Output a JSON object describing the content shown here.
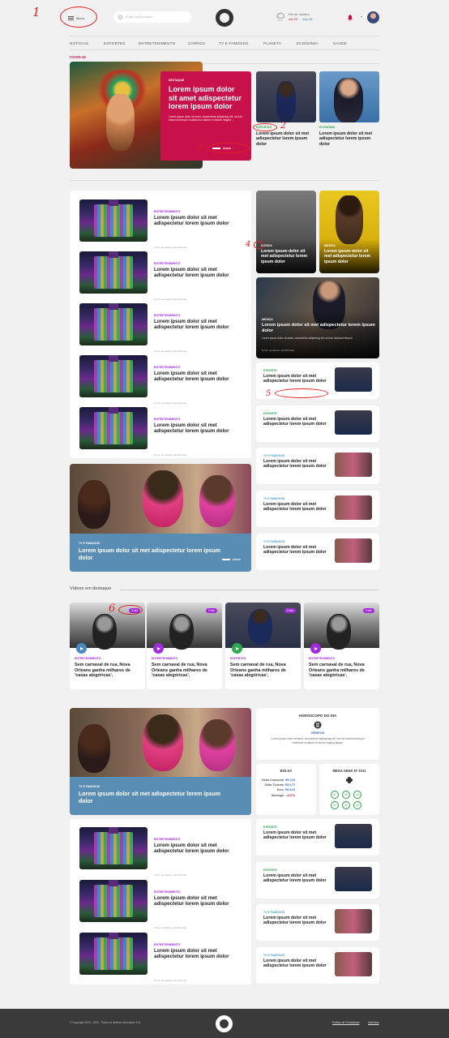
{
  "header": {
    "menu_label": "Menu",
    "search_placeholder": "O que você procura?",
    "weather_city": "Rio de Janeiro",
    "weather_min": "min 20°",
    "weather_max": "max 28°"
  },
  "nav": [
    "NOTÍCIAS",
    "ESPORTES",
    "ENTRETENIMENTO",
    "CARROS",
    "TV E FAMOSOS",
    "PLANETA",
    "ECONOMIA",
    "SAÚDE"
  ],
  "section_label": "COVID-19",
  "hero": {
    "kicker": "DESTAQUE",
    "title": "Lorem ipsum dolor sit amet adispectetur lorem ipsum dolor",
    "summary": "Lorem ipsum dolor sit amet, consectetur adipiscing elit, sed do eiusmod tempor incididunt ut labore et dolore magna ..."
  },
  "top_cards": [
    {
      "kicker": "ESPORTES",
      "title": "Lorem ipsum dolor sit met adispectetur lorem ipsum dolor"
    },
    {
      "kicker": "ECONOMIA",
      "title": "Lorem ipsum dolor sit met adispectetur lorem ipsum dolor"
    }
  ],
  "list_item": {
    "kicker": "ENTRETENIMENTO",
    "title": "Lorem ipsum dolor sit met adispectetur lorem ipsum dolor",
    "meta": "5 min. de leitura • há 20 horas"
  },
  "music_cards": [
    {
      "kicker": "MÚSICA",
      "title": "Lorem ipsum dolor sit met adispectetur lorem ipsum dolor"
    },
    {
      "kicker": "MÚSICA",
      "title": "Lorem ipsum dolor sit met adispectetur lorem ipsum dolor"
    }
  ],
  "music_big": {
    "kicker": "MÚSICA",
    "title": "Lorem ipsum dolor sit met adispectetur lorem ipsum dolor",
    "summary": "Lorem ipsum dolor sit amet, consectetur adipiscing elit, sed do eiusmod tempor",
    "meta": "5 min. de leitura • há 20 horas"
  },
  "side_cards": [
    {
      "kicker": "ESPORTE",
      "title": "Lorem ipsum dolor sit met adispectetur lorem ipsum dolor",
      "color": "#2fa84f"
    },
    {
      "kicker": "ESPORTE",
      "title": "Lorem ipsum dolor sit met adispectetur lorem ipsum dolor",
      "color": "#2fa84f"
    },
    {
      "kicker": "TV E FAMOSOS",
      "title": "Lorem ipsum dolor sit met adispectetur lorem ipsum dolor",
      "color": "#4aa0c8"
    },
    {
      "kicker": "TV E FAMOSOS",
      "title": "Lorem ipsum dolor sit met adispectetur lorem ipsum dolor",
      "color": "#4aa0c8"
    },
    {
      "kicker": "TV E FAMOSOS",
      "title": "Lorem ipsum dolor sit met adispectetur lorem ipsum dolor",
      "color": "#4aa0c8"
    }
  ],
  "big_tv": {
    "kicker": "TV E FAMOSOS",
    "title": "Lorem ipsum dolor sit met adispectetur lorem ipsum dolor"
  },
  "videos": {
    "heading": "Vídeos em destaque",
    "items": [
      {
        "badge": "3 min",
        "kicker": "ENTRETENIMENTO",
        "title": "Sem carnaval de rua, Nova Orleans ganha milhares de 'casas alegóricas'."
      },
      {
        "badge": "3 min",
        "kicker": "ENTRETENIMENTO",
        "title": "Sem carnaval de rua, Nova Orleans ganha milhares de 'casas alegóricas'."
      },
      {
        "badge": "3 min",
        "kicker": "ESPORTES",
        "title": "Sem carnaval de rua, Nova Orleans ganha milhares de 'casas alegóricas'."
      },
      {
        "badge": "3 min",
        "kicker": "ENTRETENIMENTO",
        "title": "Sem carnaval de rua, Nova Orleans ganha milhares de 'casas alegóricas'."
      }
    ]
  },
  "horoscope": {
    "heading": "HORÓSCOPO DO DIA",
    "sign": "GÊMEOS",
    "text": "Lorem ipsum dolor sit amet, consectetur adipiscing elit, sed do eiusmod tempor incididunt ut labore et dolore magna aliqua."
  },
  "bolsa": {
    "heading": "BOLSA",
    "rows": [
      {
        "label": "Dólar Comercial",
        "value": "R$ 5,53"
      },
      {
        "label": "Dólar Turismo",
        "value": "R$ 5,77"
      },
      {
        "label": "Euro",
        "value": "R$ 6,02"
      },
      {
        "label": "Ibovespa",
        "value": "- 4,07%"
      }
    ]
  },
  "mega": {
    "heading": "MEGA SENA Nº 1011",
    "numbers": [
      "01",
      "05",
      "12",
      "21",
      "31",
      "44"
    ]
  },
  "footer": {
    "copyright": "© Copyright 2020 - 2021 - Todos os direitos reservados S.A.",
    "privacy": "Política de Privacidade",
    "terms": "Interesse"
  },
  "annotations": [
    "1",
    "2",
    "3",
    "4",
    "5",
    "6"
  ],
  "colors": {
    "accent": "#c8104b",
    "kicker_green": "#2fa84f",
    "tv_blue": "#5a8db4",
    "purple": "#a22cd8",
    "footer": "#3a3a3a"
  }
}
